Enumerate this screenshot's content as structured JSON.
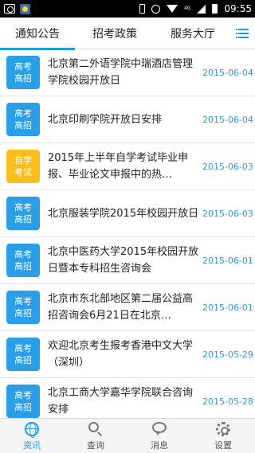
{
  "status_bar": {
    "network": "4G",
    "time": "09:55"
  },
  "tabs": [
    {
      "label": "通知公告"
    },
    {
      "label": "招考政策"
    },
    {
      "label": "服务大厅"
    }
  ],
  "items": [
    {
      "tag_line1": "高考",
      "tag_line2": "高招",
      "tag_color": "#2a9ee6",
      "title": "北京第二外语学院中瑞酒店管理学院校园开放日",
      "date": "2015-06-04"
    },
    {
      "tag_line1": "高考",
      "tag_line2": "高招",
      "tag_color": "#2a9ee6",
      "title": "北京印刷学院开放日安排",
      "date": "2015-06-04"
    },
    {
      "tag_line1": "自学",
      "tag_line2": "考试",
      "tag_color": "#f9bf1c",
      "title": "2015年上半年自学考试毕业申报、毕业论文申报中的热…",
      "date": "2015-06-03"
    },
    {
      "tag_line1": "高考",
      "tag_line2": "高招",
      "tag_color": "#2a9ee6",
      "title": "北京服装学院2015年校园开放日",
      "date": "2015-06-03"
    },
    {
      "tag_line1": "高考",
      "tag_line2": "高招",
      "tag_color": "#2a9ee6",
      "title": "北京中医药大学2015年校园开放日暨本专科招生咨询会",
      "date": "2015-06-01"
    },
    {
      "tag_line1": "高考",
      "tag_line2": "高招",
      "tag_color": "#2a9ee6",
      "title": "北京市东北部地区第二届公益高招咨询会6月21日在北京…",
      "date": "2015-06-01"
    },
    {
      "tag_line1": "高考",
      "tag_line2": "高招",
      "tag_color": "#2a9ee6",
      "title": "欢迎北京考生报考香港中文大学（深圳）",
      "date": "2015-05-29"
    },
    {
      "tag_line1": "高考",
      "tag_line2": "高招",
      "tag_color": "#2a9ee6",
      "title": "北京工商大学嘉华学院联合咨询安排",
      "date": "2015-05-28"
    }
  ],
  "bottom_nav": [
    {
      "label": "资讯",
      "icon": "globe-icon"
    },
    {
      "label": "查询",
      "icon": "search-icon"
    },
    {
      "label": "消息",
      "icon": "chat-bubble-icon"
    },
    {
      "label": "设置",
      "icon": "gear-icon"
    }
  ],
  "colors": {
    "accent": "#1e9de0",
    "tag_blue": "#2a9ee6",
    "tag_yellow": "#f9bf1c",
    "date": "#2d9bd6"
  }
}
